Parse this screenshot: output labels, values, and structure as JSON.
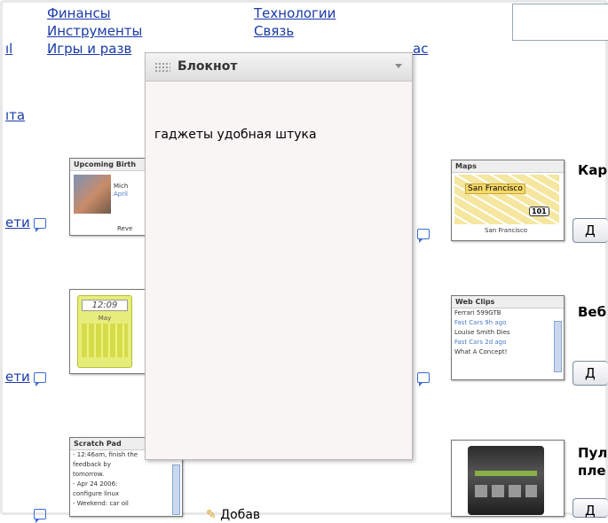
{
  "nav": {
    "col1": [
      "Финансы",
      "Инструменты",
      "Игры и разв"
    ],
    "col2": [
      "Технологии",
      "Связь",
      "ас"
    ],
    "left_fragment": "ıl"
  },
  "left_links": {
    "top": "ıта",
    "row1": "ети",
    "row2": "ети"
  },
  "notepad": {
    "title": "Блокнот",
    "body_text": "гаджеты удобная штука"
  },
  "gadgets_left": {
    "birthdays": {
      "title": "Upcoming Birth",
      "name": "Mich",
      "date": "April",
      "footer": "Reve"
    },
    "calendar": {
      "time": "12:09",
      "month": "May"
    },
    "scratch": {
      "title": "Scratch Pad",
      "lines": [
        "- 12:46am, finish the",
        "feedback by",
        "tomorrow.",
        "- Apr 24 2006:",
        "configure linux",
        "- Weekend: car oil"
      ]
    }
  },
  "gadgets_right": {
    "maps": {
      "title": "Maps",
      "label1": "San Francisco",
      "label2": "San Francisco",
      "shield": "101",
      "side_title": "Кар",
      "add_label": "Д"
    },
    "webclips": {
      "title": "Web Clips",
      "items": [
        {
          "headline": "Ferrari 599GTB",
          "source": "Fast Cars",
          "age": "9h ago"
        },
        {
          "headline": "Louise Smith Dies",
          "source": "Fast Cars",
          "age": "2d ago"
        },
        {
          "headline": "What A Concept!",
          "source": "",
          "age": ""
        }
      ],
      "side_title": "Веб",
      "add_label": "Д"
    },
    "player": {
      "side_title_1": "Пул",
      "side_title_2": "пле",
      "add_label": "Д"
    }
  },
  "bottom_fragment": "Добав"
}
